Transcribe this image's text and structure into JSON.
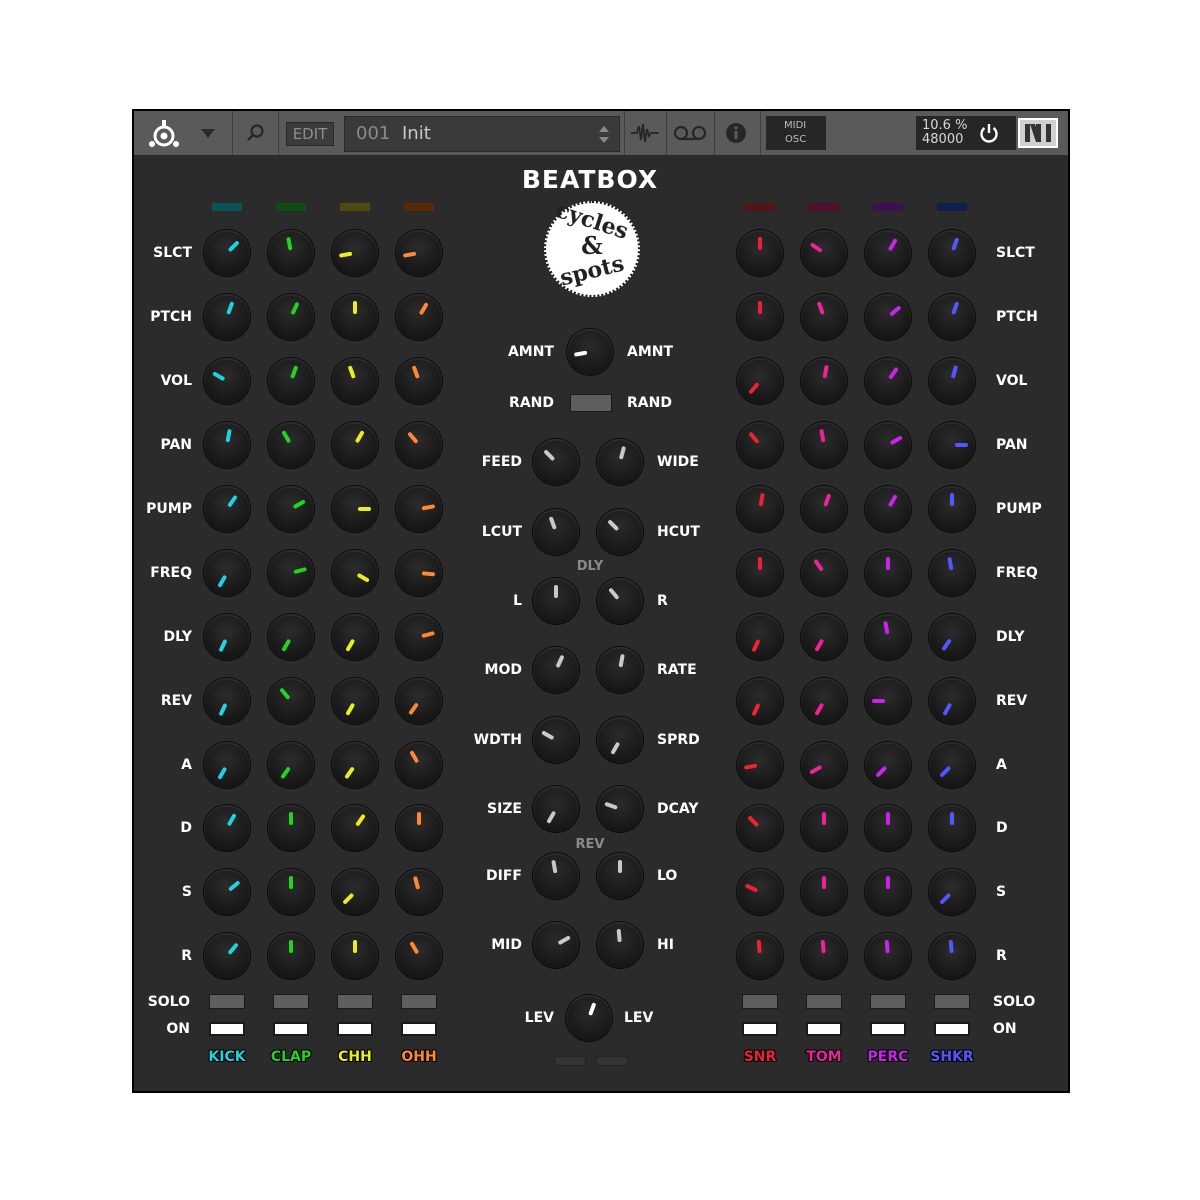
{
  "toolbar": {
    "edit_label": "EDIT",
    "preset_number": "001",
    "preset_name": "Init",
    "midi_label": "MIDI",
    "osc_label": "OSC",
    "cpu_label": "10.6 %",
    "sample_rate": "48000"
  },
  "title": "BEATBOX",
  "logo": {
    "line1": "cycles",
    "line2": "&",
    "line3": "spots"
  },
  "param_labels": [
    "SLCT",
    "PTCH",
    "VOL",
    "PAN",
    "PUMP",
    "FREQ",
    "DLY",
    "REV",
    "A",
    "D",
    "S",
    "R"
  ],
  "solo_label": "SOLO",
  "on_label": "ON",
  "channels": [
    {
      "name": "KICK",
      "color": "#1ed2e0",
      "swatch": "#0b5358",
      "angles": [
        45,
        20,
        -60,
        10,
        35,
        -150,
        -155,
        -155,
        -150,
        30,
        50,
        40
      ],
      "on": true
    },
    {
      "name": "CLAP",
      "color": "#22d422",
      "swatch": "#0f4d13",
      "angles": [
        -10,
        25,
        20,
        -30,
        60,
        75,
        -150,
        -40,
        -145,
        0,
        0,
        0
      ],
      "on": true
    },
    {
      "name": "CHH",
      "color": "#ecec22",
      "swatch": "#4f4b10",
      "angles": [
        -100,
        0,
        -20,
        30,
        90,
        120,
        -150,
        -150,
        -145,
        35,
        -135,
        0
      ],
      "on": true
    },
    {
      "name": "OHH",
      "color": "#ff8833",
      "swatch": "#5a2a08",
      "angles": [
        -100,
        30,
        -20,
        -40,
        80,
        95,
        75,
        -145,
        -30,
        0,
        -15,
        -30
      ],
      "on": true
    },
    {
      "name": "SNR",
      "color": "#ee2233",
      "swatch": "#521515",
      "angles": [
        0,
        0,
        -140,
        -40,
        10,
        0,
        -155,
        -155,
        -100,
        -45,
        -65,
        -5
      ],
      "on": true
    },
    {
      "name": "TOM",
      "color": "#ee2299",
      "swatch": "#50102d",
      "angles": [
        -55,
        -20,
        10,
        -10,
        20,
        -35,
        -150,
        -150,
        -120,
        0,
        0,
        -5
      ],
      "on": true
    },
    {
      "name": "PERC",
      "color": "#cc22ee",
      "swatch": "#3f0f52",
      "angles": [
        30,
        50,
        35,
        60,
        30,
        0,
        -10,
        -90,
        -135,
        0,
        0,
        -5
      ],
      "on": true
    },
    {
      "name": "SHKR",
      "color": "#5555ff",
      "swatch": "#10204e",
      "angles": [
        20,
        20,
        15,
        90,
        0,
        -10,
        -145,
        -150,
        -135,
        0,
        -135,
        -5
      ],
      "on": true
    }
  ],
  "center": {
    "amnt_label": "AMNT",
    "rand_label": "RAND",
    "dly_section_label": "DLY",
    "rev_section_label": "REV",
    "lev_label": "LEV",
    "rows": [
      {
        "left": "FEED",
        "right": "WIDE",
        "a1": -45,
        "a2": 15
      },
      {
        "left": "LCUT",
        "right": "HCUT",
        "a1": -20,
        "a2": -45
      },
      {
        "left": "L",
        "right": "R",
        "a1": 0,
        "a2": -40
      },
      {
        "left": "MOD",
        "right": "RATE",
        "a1": 25,
        "a2": 10
      },
      {
        "left": "WDTH",
        "right": "SPRD",
        "a1": -60,
        "a2": -150
      },
      {
        "left": "SIZE",
        "right": "DCAY",
        "a1": -150,
        "a2": -70
      },
      {
        "left": "DIFF",
        "right": "LO",
        "a1": -10,
        "a2": 0
      },
      {
        "left": "MID",
        "right": "HI",
        "a1": 60,
        "a2": -5
      }
    ],
    "amnt_angle": -100,
    "lev_angle": 20
  }
}
